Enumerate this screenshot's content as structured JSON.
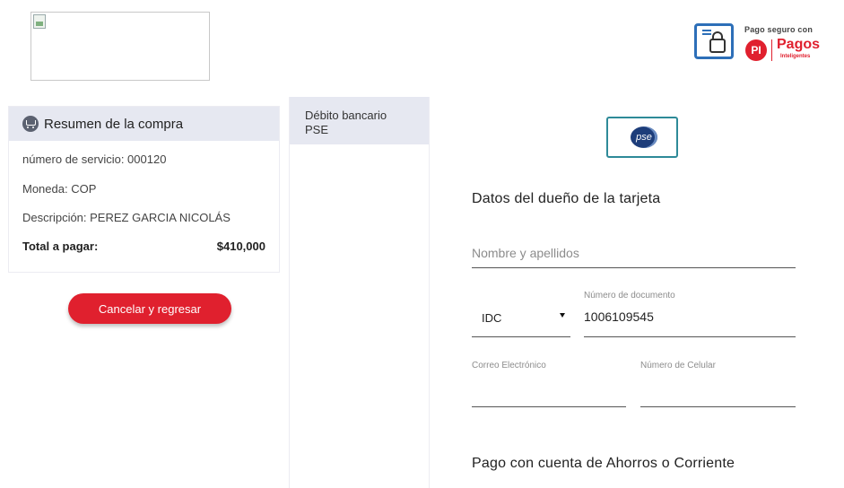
{
  "secure_badge": {
    "label": "Pago seguro con",
    "brand_initials": "PI",
    "brand_name": "Pagos",
    "brand_sub": "Inteligentes"
  },
  "summary": {
    "title": "Resumen de la compra",
    "service_number": "número de servicio: 000120",
    "currency": "Moneda: COP",
    "description": "Descripción: PEREZ GARCIA NICOLÁS",
    "total_label": "Total a pagar:",
    "total_value": "$410,000"
  },
  "cancel_button": "Cancelar y regresar",
  "payment_methods": [
    {
      "label_line1": "Débito bancario",
      "label_line2": "PSE"
    }
  ],
  "pse_logo_text": "pse",
  "form": {
    "owner_heading": "Datos del dueño de la tarjeta",
    "name_placeholder": "Nombre y apellidos",
    "doc_type_value": "IDC",
    "doc_number_label": "Número de documento",
    "doc_number_value": "1006109545",
    "email_label": "Correo Electrónico",
    "phone_label": "Número de Celular",
    "account_heading": "Pago con cuenta de Ahorros o Corriente"
  },
  "colors": {
    "accent_red": "#e0202e",
    "header_bg": "#e6e8f1",
    "pse_border": "#2e8a98",
    "lock_blue": "#2d6fb8"
  }
}
